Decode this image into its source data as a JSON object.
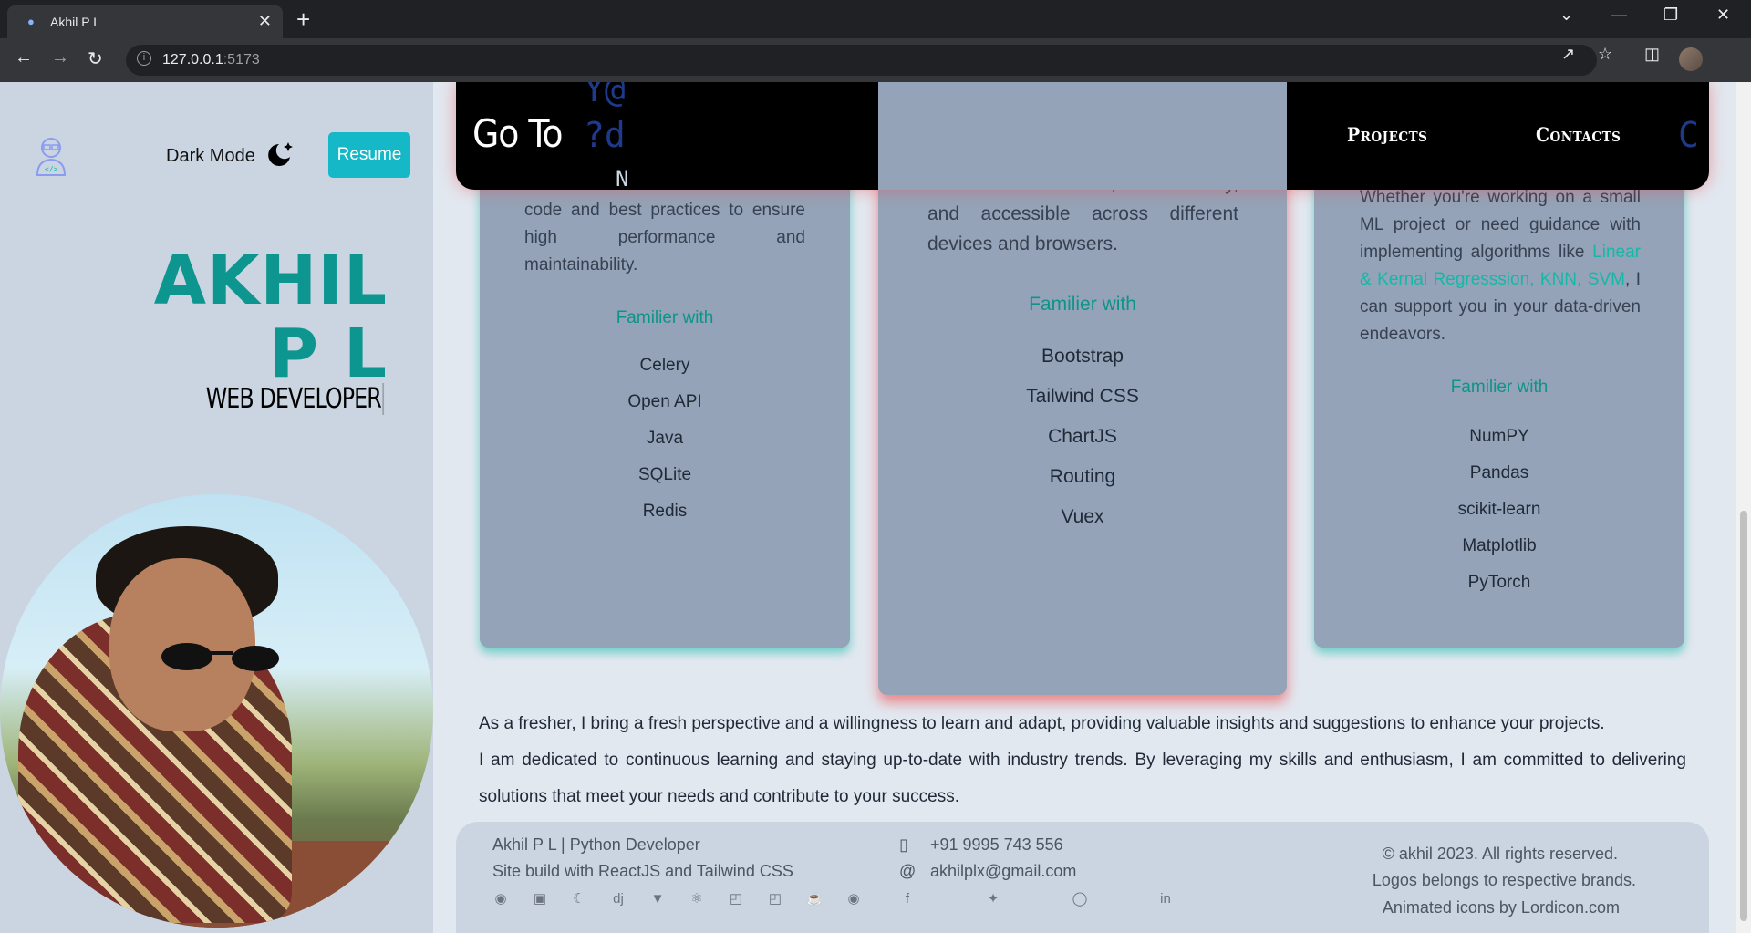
{
  "browser": {
    "tab_title": "Akhil P L",
    "url_host": "127.0.0.1",
    "url_port": ":5173"
  },
  "sidebar": {
    "dark_mode_label": "Dark Mode",
    "resume_label": "Resume",
    "name_line1": "AKHIL",
    "name_line2": "P L",
    "role": "WEB DEVELOPER"
  },
  "nav": {
    "title": "Go To",
    "links": [
      "Projects",
      "Contacts"
    ]
  },
  "cards": {
    "left": {
      "desc": "code and best practices to ensure high performance and maintainability.",
      "familiar_label": "Familier with",
      "items": [
        "Celery",
        "Open API",
        "Java",
        "SQLite",
        "Redis"
      ]
    },
    "middle": {
      "desc": "appealing and responsive user interfaces. By employing modern design principles, I ensure that your website is attractive, user-friendly, and accessible across different devices and browsers.",
      "familiar_label": "Familier with",
      "items": [
        "Bootstrap",
        "Tailwind CSS",
        "ChartJS",
        "Routing",
        "Vuex"
      ]
    },
    "right": {
      "desc_part1": "Whether you're working on a small ML project or need guidance with implementing algorithms like ",
      "desc_highlight": "Linear & Kernal Regresssion, KNN, SVM",
      "desc_part2": ", I can support you in your data-driven endeavors.",
      "familiar_label": "Familier with",
      "items": [
        "NumPY",
        "Pandas",
        "scikit-learn",
        "Matplotlib",
        "PyTorch"
      ]
    }
  },
  "about": {
    "line1": "As a fresher, I bring a fresh perspective and a willingness to learn and adapt, providing valuable insights and suggestions to enhance your projects.",
    "line2": "I am dedicated to continuous learning and staying up-to-date with industry trends. By leveraging my skills and enthusiasm, I am committed to delivering solutions that meet your needs and contribute to your success."
  },
  "footer": {
    "tagline": "Akhil P L | Python Developer",
    "built_with": "Site build with ReactJS and Tailwind CSS",
    "phone": "+91 9995 743 556",
    "email": "akhilplx@gmail.com",
    "copyright": "© akhil 2023. All rights reserved.",
    "logos_note": "Logos belongs to respective brands.",
    "icons_note": "Animated icons by Lordicon.com",
    "tech_icons": [
      "python-icon",
      "js-icon",
      "mongo-icon",
      "django-icon",
      "vue-icon",
      "react-icon",
      "css3-icon",
      "html5-icon",
      "java-icon",
      "github-icon"
    ],
    "social_icons": [
      "facebook-icon",
      "twitter-icon",
      "instagram-icon",
      "linkedin-icon"
    ]
  },
  "colors": {
    "accent": "#14b8c6",
    "name": "#0d968f",
    "card": "#94a3b8",
    "page_bg": "#e2e8f0",
    "sidebar_bg": "#cbd5e1"
  }
}
